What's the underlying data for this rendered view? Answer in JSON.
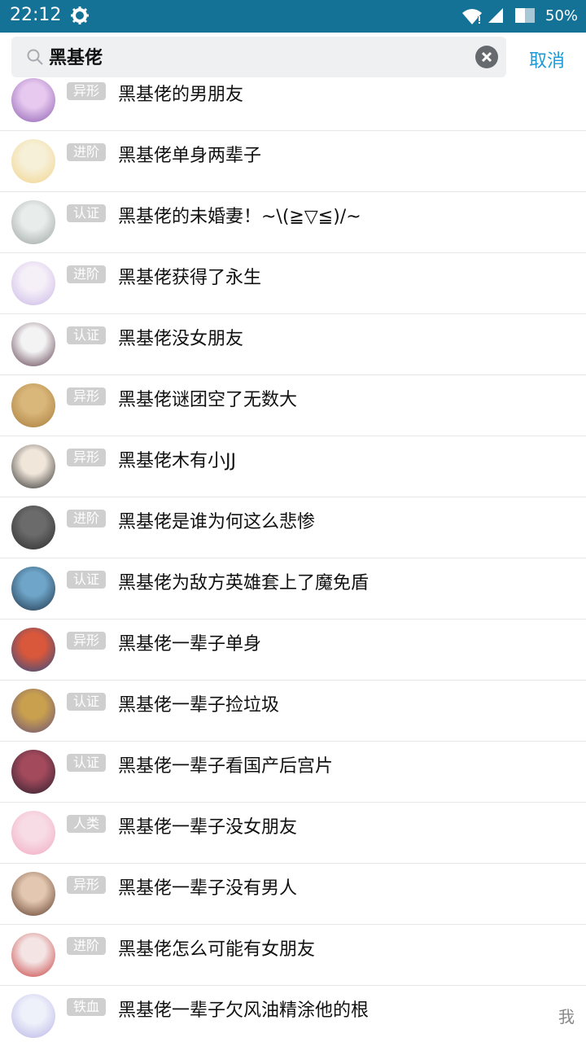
{
  "status_bar": {
    "time": "22:12",
    "battery": "50%",
    "icons": [
      "gear-icon",
      "wifi-icon",
      "signal-icon",
      "battery-icon"
    ]
  },
  "search": {
    "query": "黑基佬",
    "cancel_label": "取消"
  },
  "results": [
    {
      "badge": "异形",
      "title": "黑基佬的男朋友",
      "avatar_colors": [
        "#8a5cb0",
        "#e7c9ef"
      ]
    },
    {
      "badge": "进阶",
      "title": "黑基佬单身两辈子",
      "avatar_colors": [
        "#f2d38a",
        "#f6f0d8"
      ]
    },
    {
      "badge": "认证",
      "title": "黑基佬的未婚妻！~\\(≧▽≦)/~",
      "avatar_colors": [
        "#9aa3a0",
        "#e8ecea"
      ]
    },
    {
      "badge": "进阶",
      "title": "黑基佬获得了永生",
      "avatar_colors": [
        "#c9b6e6",
        "#f5eff8"
      ]
    },
    {
      "badge": "认证",
      "title": "黑基佬没女朋友",
      "avatar_colors": [
        "#5b3a4c",
        "#f3f3f3"
      ]
    },
    {
      "badge": "异形",
      "title": "黑基佬谜团空了无数大",
      "avatar_colors": [
        "#a67b3a",
        "#d9b67a"
      ]
    },
    {
      "badge": "异形",
      "title": "黑基佬木有小JJ",
      "avatar_colors": [
        "#2a2a2a",
        "#f0e6da"
      ]
    },
    {
      "badge": "进阶",
      "title": "黑基佬是谁为何这么悲惨",
      "avatar_colors": [
        "#2b2b2b",
        "#6b6b6b"
      ]
    },
    {
      "badge": "认证",
      "title": "黑基佬为敌方英雄套上了魔免盾",
      "avatar_colors": [
        "#1d3146",
        "#6ea5c8"
      ]
    },
    {
      "badge": "异形",
      "title": "黑基佬一辈子单身",
      "avatar_colors": [
        "#2a4e86",
        "#d9573b"
      ]
    },
    {
      "badge": "认证",
      "title": "黑基佬一辈子捡垃圾",
      "avatar_colors": [
        "#6a4f7a",
        "#c9a04e"
      ]
    },
    {
      "badge": "认证",
      "title": "黑基佬一辈子看国产后宫片",
      "avatar_colors": [
        "#2a1e2e",
        "#a34a5c"
      ]
    },
    {
      "badge": "人类",
      "title": "黑基佬一辈子没女朋友",
      "avatar_colors": [
        "#f2a9c0",
        "#f7dce6"
      ]
    },
    {
      "badge": "异形",
      "title": "黑基佬一辈子没有男人",
      "avatar_colors": [
        "#5a3a2a",
        "#e4c7b0"
      ]
    },
    {
      "badge": "进阶",
      "title": "黑基佬怎么可能有女朋友",
      "avatar_colors": [
        "#c63b3b",
        "#f4e4e4"
      ]
    },
    {
      "badge": "铁血",
      "title": "黑基佬一辈子欠风油精涂他的根",
      "avatar_colors": [
        "#b7b4e6",
        "#eef0fa"
      ],
      "trailing": "我"
    }
  ]
}
